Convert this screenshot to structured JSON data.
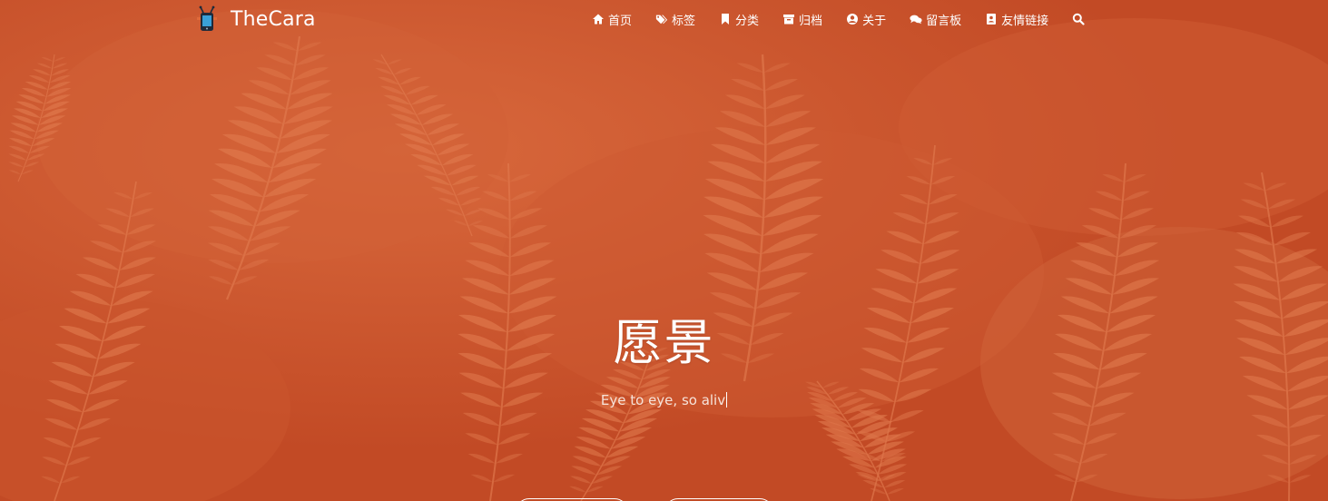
{
  "header": {
    "brand_name": "TheCara",
    "logo_icon": "phone-antenna-logo-icon"
  },
  "nav": {
    "items": [
      {
        "label": "首页",
        "icon": "home-icon"
      },
      {
        "label": "标签",
        "icon": "tags-icon"
      },
      {
        "label": "分类",
        "icon": "bookmark-icon"
      },
      {
        "label": "归档",
        "icon": "archive-icon"
      },
      {
        "label": "关于",
        "icon": "user-circle-icon"
      },
      {
        "label": "留言板",
        "icon": "comments-icon"
      },
      {
        "label": "友情链接",
        "icon": "address-card-icon"
      }
    ],
    "search_icon": "search-icon"
  },
  "hero": {
    "title": "愿景",
    "subtitle": "Eye to eye, so aliv",
    "background_tint": "#c5502a",
    "fern_color": "#e07a4e"
  }
}
